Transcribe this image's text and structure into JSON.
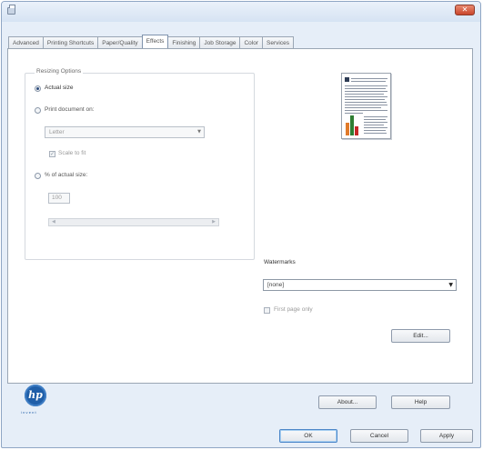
{
  "window": {
    "close_glyph": "✕"
  },
  "tabs": [
    {
      "label": "Advanced"
    },
    {
      "label": "Printing Shortcuts"
    },
    {
      "label": "Paper/Quality"
    },
    {
      "label": "Effects",
      "active": true
    },
    {
      "label": "Finishing"
    },
    {
      "label": "Job Storage"
    },
    {
      "label": "Color"
    },
    {
      "label": "Services"
    }
  ],
  "resizing": {
    "title": "Resizing Options",
    "actual_size_label": "Actual size",
    "print_on_label": "Print document on:",
    "paper_value": "Letter",
    "scale_to_fit_label": "Scale to fit",
    "percent_label": "% of actual size:",
    "percent_value": "100",
    "selected": "actual_size"
  },
  "watermarks": {
    "title": "Watermarks",
    "value": "[none]",
    "first_page_only_label": "First page only",
    "edit_label": "Edit..."
  },
  "branding": {
    "tagline": "invent"
  },
  "buttons": {
    "about": "About...",
    "help": "Help",
    "ok": "OK",
    "cancel": "Cancel",
    "apply": "Apply"
  },
  "icons": {
    "dropdown": "▼",
    "slider_left": "◀",
    "slider_right": "▶",
    "check": "✓"
  },
  "colors": {
    "accent": "#1f5ea8",
    "preview_bars": [
      "#e07a2a",
      "#2e7d32",
      "#c62828"
    ]
  }
}
